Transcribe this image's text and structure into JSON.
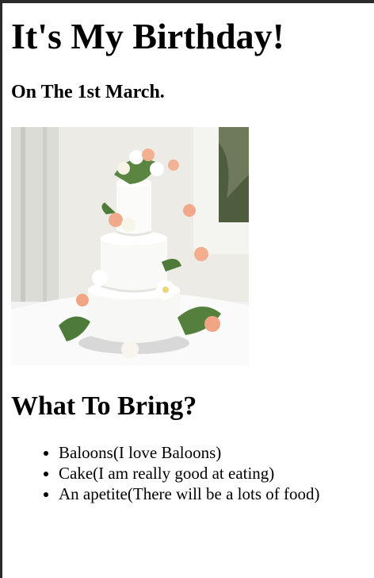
{
  "heading": "It's My Birthday!",
  "date": "On The 1st March.",
  "image": {
    "icon": "wedding-cake-photo"
  },
  "bring": {
    "title": "What To Bring?",
    "items": [
      "Baloons(I love Baloons)",
      "Cake(I am really good at eating)",
      "An apetite(There will be a lots of food)"
    ]
  }
}
